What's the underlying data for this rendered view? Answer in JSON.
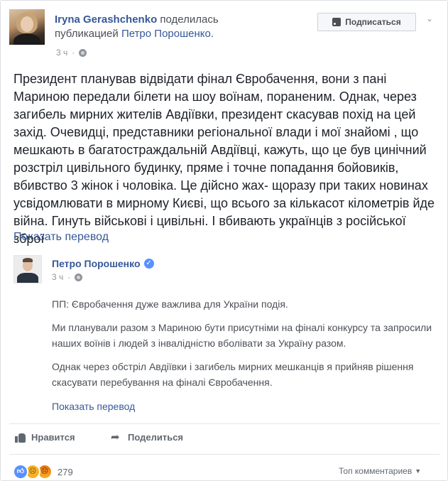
{
  "header": {
    "author": "Iryna Gerashchenko",
    "action_text": "поделилась",
    "action_text_2": "публикацией",
    "shared_from": "Петро Порошенко.",
    "time": "3 ч",
    "subscribe_label": "Подписаться"
  },
  "post": {
    "text": "Президент планував відвідати фінал Євробачення, вони з пані Мариною передали білети на шоу воїнам, пораненим. Однак, через загибель мирних жителів Авдіївки, президент скасував похід на цей захід. Очевидці, представники регіональної влади і мої знайомі , що мешкають в багатостраждальній Авдіївці, кажуть, що це був цинічний розстріл цивільного будинку, пряме і точне попадання бойовиків, вбивство 3 жінок і чоловіка. Це дійсно жах- щоразу при таких новинах усвідомлювати в мирному Києві, що всього за кількасот кілометрів йде війна. Гинуть військові і цивільні. І вбивають українців з російської зброї",
    "translate_label": "Показать перевод"
  },
  "shared_post": {
    "author": "Петро Порошенко",
    "time": "3 ч",
    "paragraphs": [
      "ПП: Євробачення дуже важлива для України подія.",
      "Ми планували разом з Мариною бути присутніми на фіналі конкурсу та запросили наших воїнів і людей з інвалідністю вболівати за Україну разом.",
      "Однак через обстріл Авдіївки і загибель мирних мешканців я прийняв рішення скасувати перебування на фіналі Євробачення."
    ],
    "translate_label": "Показать перевод"
  },
  "actions": {
    "like_label": "Нравится",
    "share_label": "Поделиться"
  },
  "footer": {
    "reaction_count": "279",
    "top_comments_label": "Топ комментариев"
  },
  "colors": {
    "link": "#365899",
    "text": "#1d2129",
    "meta": "#90949c"
  }
}
